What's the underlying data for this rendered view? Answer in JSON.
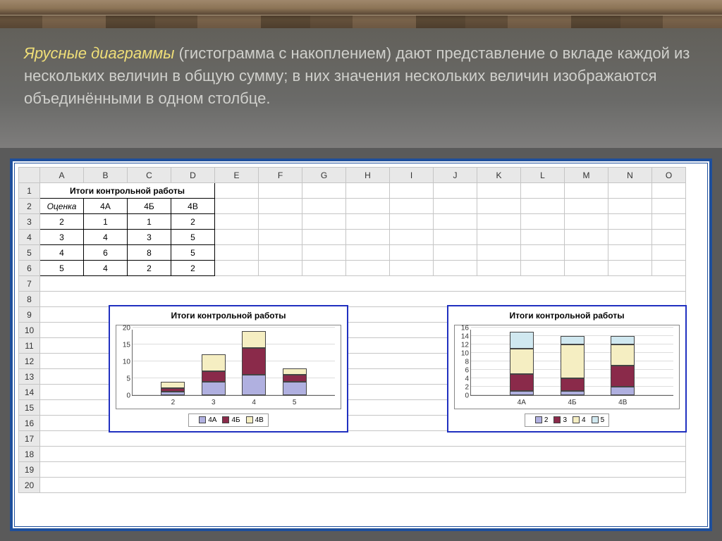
{
  "slide_text": {
    "highlight": "Ярусные диаграммы",
    "rest": " (гистограмма с накоплением) дают представление о вкладе каждой из нескольких величин в общую сумму; в них значения нескольких величин изображаются объединёнными в одном столбце."
  },
  "spreadsheet": {
    "col_headers": [
      "A",
      "B",
      "C",
      "D",
      "E",
      "F",
      "G",
      "H",
      "I",
      "J",
      "K",
      "L",
      "M",
      "N",
      "O"
    ],
    "row_headers": [
      "1",
      "2",
      "3",
      "4",
      "5",
      "6",
      "7",
      "8",
      "9",
      "10",
      "11",
      "12",
      "13",
      "14",
      "15",
      "16",
      "17",
      "18",
      "19",
      "20"
    ],
    "data": {
      "title": "Итоги контрольной работы",
      "header": [
        "Оценка",
        "4А",
        "4Б",
        "4В"
      ],
      "rows": [
        [
          "2",
          "1",
          "1",
          "2"
        ],
        [
          "3",
          "4",
          "3",
          "5"
        ],
        [
          "4",
          "6",
          "8",
          "5"
        ],
        [
          "5",
          "4",
          "2",
          "2"
        ]
      ]
    }
  },
  "chart_data": [
    {
      "type": "stacked-bar",
      "title": "Итоги контрольной работы",
      "categories": [
        "2",
        "3",
        "4",
        "5"
      ],
      "series": [
        {
          "name": "4А",
          "values": [
            1,
            4,
            6,
            4
          ]
        },
        {
          "name": "4Б",
          "values": [
            1,
            3,
            8,
            2
          ]
        },
        {
          "name": "4В",
          "values": [
            2,
            5,
            5,
            2
          ]
        }
      ],
      "ylim": [
        0,
        20
      ],
      "yticks": [
        0,
        5,
        10,
        15,
        20
      ]
    },
    {
      "type": "stacked-bar",
      "title": "Итоги контрольной работы",
      "categories": [
        "4А",
        "4Б",
        "4В"
      ],
      "series": [
        {
          "name": "2",
          "values": [
            1,
            1,
            2
          ]
        },
        {
          "name": "3",
          "values": [
            4,
            3,
            5
          ]
        },
        {
          "name": "4",
          "values": [
            6,
            8,
            5
          ]
        },
        {
          "name": "5",
          "values": [
            4,
            2,
            2
          ]
        }
      ],
      "ylim": [
        0,
        16
      ],
      "yticks": [
        0,
        2,
        4,
        6,
        8,
        10,
        12,
        14,
        16
      ]
    }
  ]
}
